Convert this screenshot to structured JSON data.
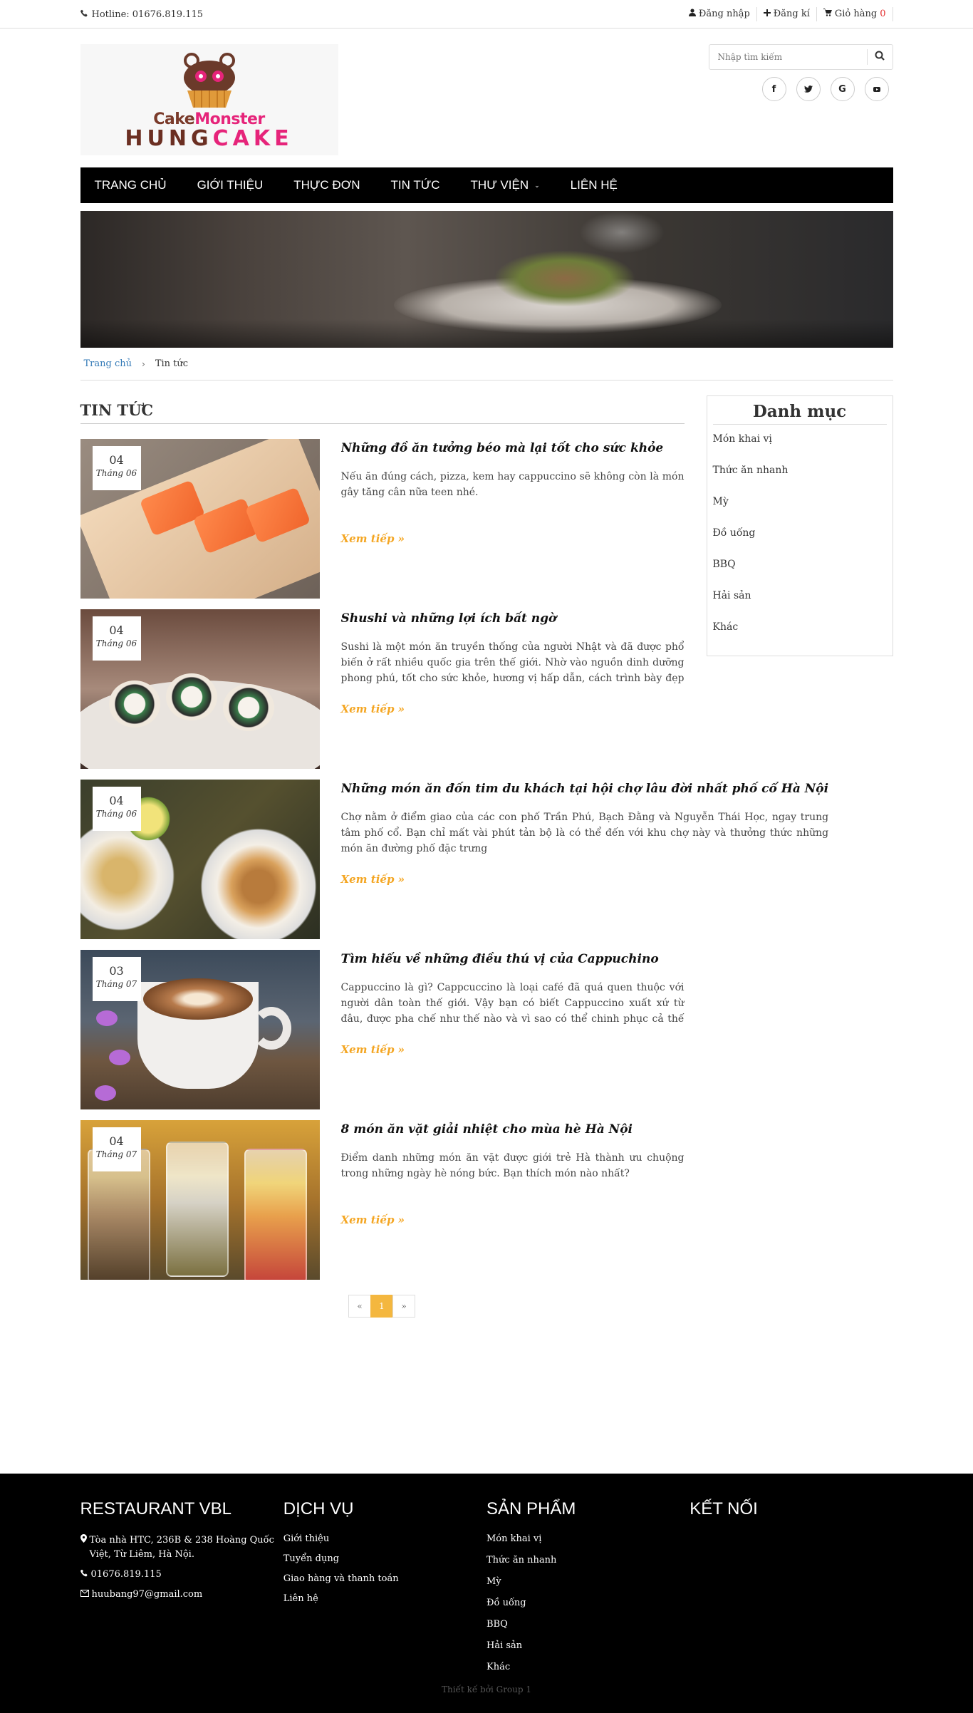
{
  "topbar": {
    "hotline": "Hotline: 01676.819.115",
    "login": "Đăng nhập",
    "register": "Đăng kí",
    "cart": "Giỏ hàng",
    "cart_count": "0"
  },
  "logo": {
    "line1_a": "Cake",
    "line1_b": "Monster",
    "line2_a": "HUNG",
    "line2_b": "CAKE"
  },
  "search": {
    "placeholder": "Nhập tìm kiếm"
  },
  "socials": [
    "f",
    "t",
    "G",
    "▶"
  ],
  "nav": [
    "TRANG CHỦ",
    "GIỚI THIỆU",
    "THỰC ĐƠN",
    "TIN TỨC",
    "THƯ VIỆN",
    "LIÊN HỆ"
  ],
  "breadcrumb": {
    "home": "Trang chủ",
    "current": "Tin tức"
  },
  "section_title": "TIN TỨC",
  "news": [
    {
      "day": "04",
      "month": "Tháng 06",
      "title": "Những đồ ăn tưởng béo mà lại tốt cho sức khỏe",
      "excerpt": "Nếu ăn đúng cách, pizza, kem hay cappuccino sẽ không còn là món gây tăng cân nữa teen nhé.",
      "more": "Xem tiếp »"
    },
    {
      "day": "04",
      "month": "Tháng 06",
      "title": "Shushi và những lợi ích bất ngờ",
      "excerpt": "Sushi là một món ăn truyền thống của người Nhật và đã được phổ biến ở rất nhiều quốc gia trên thế giới. Nhờ vào nguồn dinh dưỡng phong phú, tốt cho sức khỏe, hương vị hấp dẫn, cách trình bày đẹp mắt, món ăn này đã",
      "more": "Xem tiếp »"
    },
    {
      "day": "04",
      "month": "Tháng 06",
      "title": "Những món ăn đốn tim du khách tại hội chợ lâu đời nhất phố cổ Hà Nội",
      "excerpt": "Chợ nằm ở điểm giao của các con phố Trần Phú, Bạch Đằng và Nguyễn Thái Học, ngay trung tâm phố cổ. Bạn chỉ mất vài phút tản bộ là có thể đến với khu chợ này và thưởng thức những món ăn đường phố đặc trưng",
      "more": "Xem tiếp »"
    },
    {
      "day": "03",
      "month": "Tháng 07",
      "title": "Tìm hiểu về những điều thú vị của Cappuchino",
      "excerpt": "Cappuccino là gì? Cappcuccino là loại café đã quá quen thuộc với người dân toàn thế giới. Vậy bạn có biết Cappuccino xuất xứ từ đâu, được pha chế như thế nào và vì sao có thể chinh phục cả thế giới?",
      "more": "Xem tiếp »"
    },
    {
      "day": "04",
      "month": "Tháng 07",
      "title": "8 món ăn vặt giải nhiệt cho mùa hè Hà Nội",
      "excerpt": "Điểm danh những món ăn vặt được giới trẻ Hà thành ưu chuộng trong những ngày hè nóng bức. Bạn thích món nào nhất?",
      "more": "Xem tiếp »"
    }
  ],
  "pager": {
    "prev": "«",
    "page": "1",
    "next": "»"
  },
  "sidebar": {
    "title": "Danh mục",
    "items": [
      "Món khai vị",
      "Thức ăn nhanh",
      "Mỳ",
      "Đồ uống",
      "BBQ",
      "Hải sản",
      "Khác"
    ]
  },
  "footer": {
    "col1": {
      "title": "RESTAURANT VBL",
      "address": "Tòa nhà HTC, 236B & 238 Hoàng Quốc Việt, Từ Liêm, Hà Nội.",
      "phone": "01676.819.115",
      "email": "huubang97@gmail.com"
    },
    "col2": {
      "title": "DỊCH VỤ",
      "items": [
        "Giới thiệu",
        "Tuyển dụng",
        "Giao hàng và thanh toán",
        "Liên hệ"
      ]
    },
    "col3": {
      "title": "SẢN PHẨM",
      "items": [
        "Món khai vị",
        "Thức ăn nhanh",
        "Mỳ",
        "Đồ uống",
        "BBQ",
        "Hải sản",
        "Khác"
      ]
    },
    "col4": {
      "title": "KẾT NỐI"
    },
    "credit": "Thiết kế bởi Group 1"
  },
  "colors": {
    "accent": "#f4a623",
    "nav_bg": "#000000",
    "link": "#337ab7",
    "cart_count": "#e32d2d"
  }
}
